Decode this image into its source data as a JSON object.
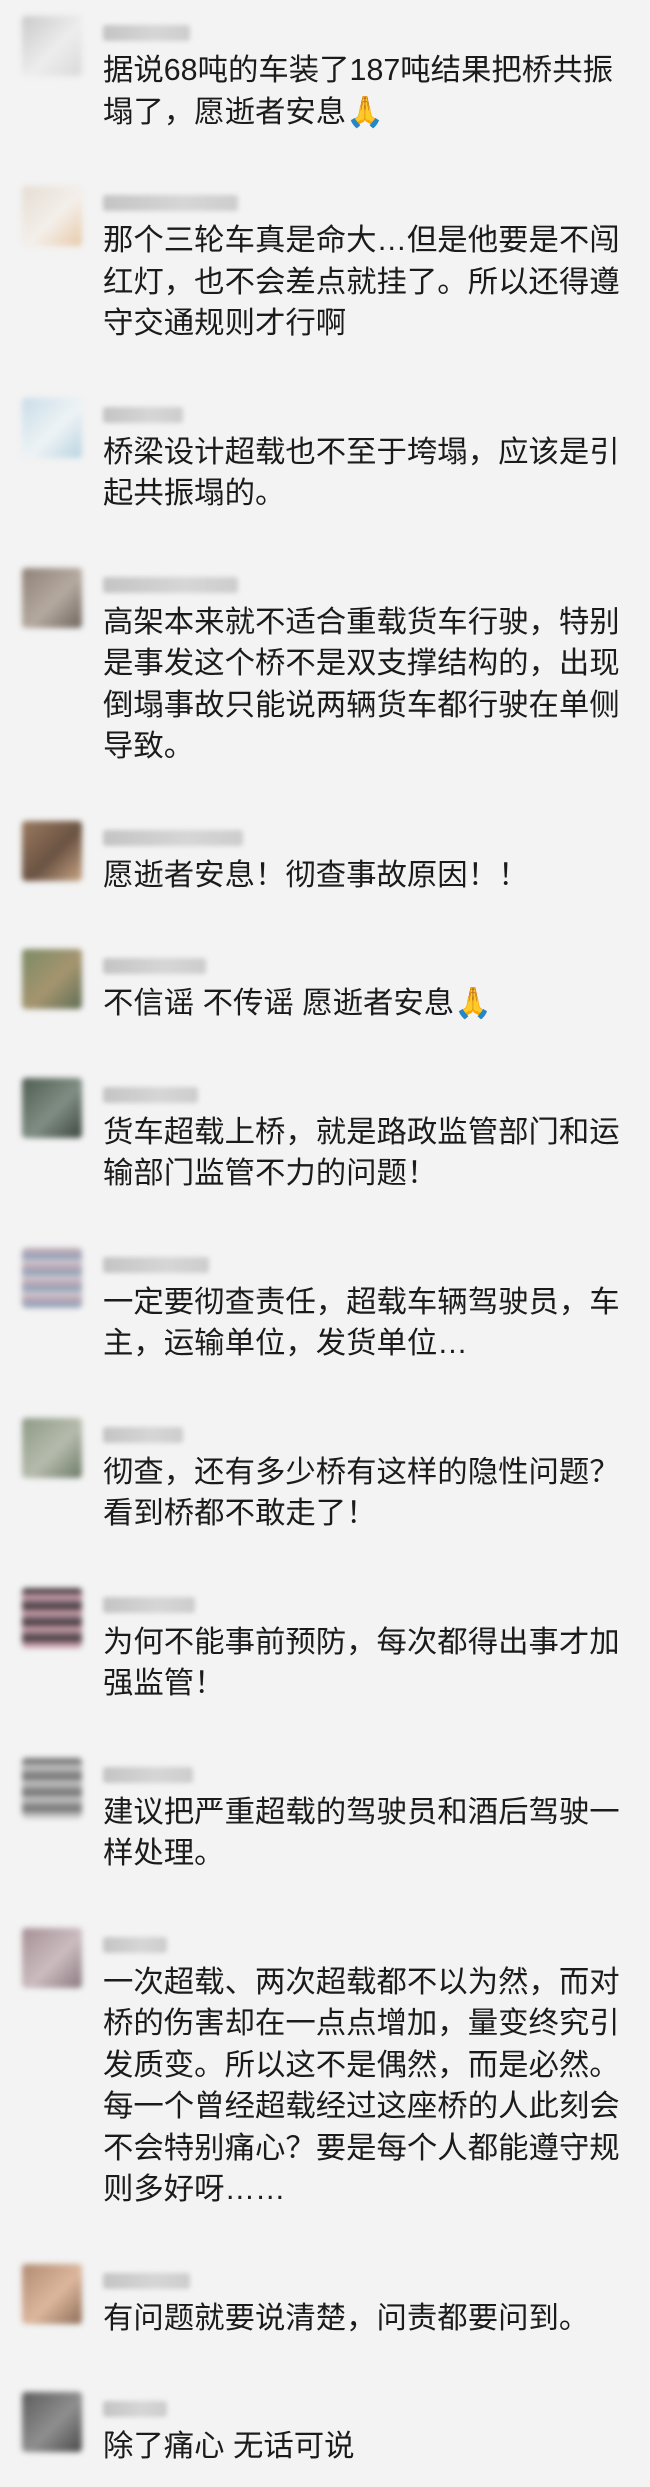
{
  "comments": [
    {
      "text": "据说68吨的车装了187吨结果把桥共振塌了，愿逝者安息🙏",
      "avatar_colors": [
        "#c9c9c9",
        "#ededed",
        "#d9d9d9"
      ]
    },
    {
      "text": "那个三轮车真是命大…但是他要是不闯红灯，也不会差点就挂了。所以还得遵守交通规则才行啊",
      "avatar_colors": [
        "#e6ddd3",
        "#f3efea",
        "#e8c9a8"
      ]
    },
    {
      "text": "桥梁设计超载也不至于垮塌，应该是引起共振塌的。",
      "avatar_colors": [
        "#c8dce8",
        "#eef3f5",
        "#b8d3e2"
      ]
    },
    {
      "text": "高架本来就不适合重载货车行驶，特别是事发这个桥不是双支撑结构的，出现倒塌事故只能说两辆货车都行驶在单侧导致。",
      "avatar_colors": [
        "#8f8278",
        "#b5aaa0",
        "#6f655e"
      ]
    },
    {
      "text": "愿逝者安息！彻查事故原因！！",
      "avatar_colors": [
        "#9a7a5f",
        "#6b5343",
        "#c8a584"
      ]
    },
    {
      "text": "不信谣 不传谣 愿逝者安息🙏",
      "avatar_colors": [
        "#7c8a66",
        "#a5956f",
        "#5f6e55"
      ]
    },
    {
      "text": "货车超载上桥，就是路政监管部门和运输部门监管不力的问题！",
      "avatar_colors": [
        "#4f5c52",
        "#808e84",
        "#3c4640"
      ]
    },
    {
      "text": "一定要彻查责任，超载车辆驾驶员，车主，运输单位，发货单位…",
      "avatar_colors": [
        "#b8a8b3",
        "#98a5bb",
        "#d6ccd2"
      ]
    },
    {
      "text": "彻查，还有多少桥有这样的隐性问题？看到桥都不敢走了！",
      "avatar_colors": [
        "#8d9985",
        "#b6bcad",
        "#6d7a68"
      ]
    },
    {
      "text": "为何不能事前预防，每次都得出事才加强监管！",
      "avatar_colors": [
        "#4e4247",
        "#c39aa7",
        "#7a6870"
      ]
    },
    {
      "text": "建议把严重超载的驾驶员和酒后驾驶一样处理。",
      "avatar_colors": [
        "#777777",
        "#bdbdbd",
        "#9a9a9a"
      ]
    },
    {
      "text": "一次超载、两次超载都不以为然，而对桥的伤害却在一点点增加，量变终究引发质变。所以这不是偶然，而是必然。每一个曾经超载经过这座桥的人此刻会不会特别痛心？要是每个人都能遵守规则多好呀……",
      "avatar_colors": [
        "#a48f95",
        "#cbbcc0",
        "#8a7a80"
      ]
    },
    {
      "text": "有问题就要说清楚，问责都要问到。",
      "avatar_colors": [
        "#b08b71",
        "#dcb79d",
        "#8e6d57"
      ]
    },
    {
      "text": "除了痛心 无话可说",
      "avatar_colors": [
        "#5c5c5c",
        "#8f8f8f",
        "#4a4a4a"
      ]
    }
  ]
}
